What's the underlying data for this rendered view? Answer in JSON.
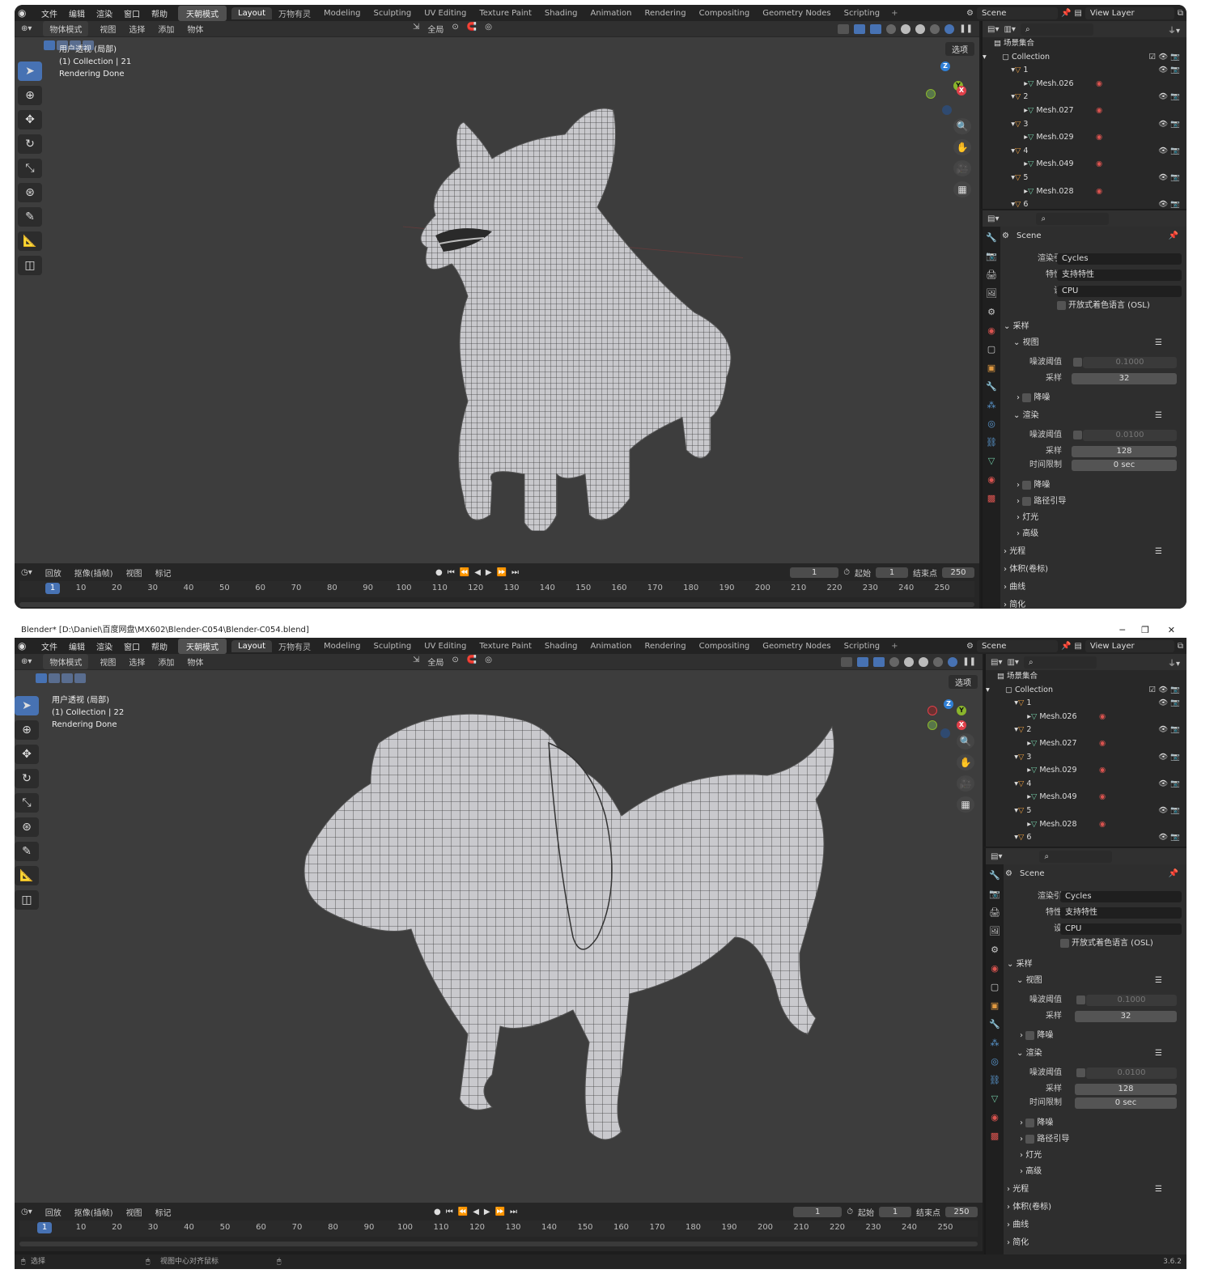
{
  "menu": {
    "items": [
      "文件",
      "编辑",
      "渲染",
      "窗口",
      "帮助"
    ],
    "mode_button": "天朝模式",
    "workspaces": [
      "Layout",
      "万物有灵",
      "Modeling",
      "Sculpting",
      "UV Editing",
      "Texture Paint",
      "Shading",
      "Animation",
      "Rendering",
      "Compositing",
      "Geometry Nodes",
      "Scripting"
    ],
    "add_workspace": "+",
    "scene": "Scene",
    "view_layer": "View Layer"
  },
  "window_title": "Blender* [D:\\Daniel\\百度网盘\\MX602\\Blender-C054\\Blender-C054.blend]",
  "viewport_header": {
    "mode": "物体模式",
    "items": [
      "视图",
      "选择",
      "添加",
      "物体"
    ],
    "transform": "全局",
    "options": "选项"
  },
  "viewport1": {
    "line1": "用户透视 (局部)",
    "line2": "(1) Collection | 21",
    "line3": "Rendering Done"
  },
  "viewport2": {
    "line1": "用户透视 (局部)",
    "line2": "(1) Collection | 22",
    "line3": "Rendering Done"
  },
  "timeline": {
    "items": [
      "回放",
      "抠像(插帧)",
      "视图",
      "标记"
    ],
    "current": "1",
    "start_label": "起始",
    "start": "1",
    "end_label": "结束点",
    "end": "250",
    "ticks": [
      "10",
      "20",
      "30",
      "40",
      "50",
      "60",
      "70",
      "80",
      "90",
      "100",
      "110",
      "120",
      "130",
      "140",
      "150",
      "160",
      "170",
      "180",
      "190",
      "200",
      "210",
      "220",
      "230",
      "240",
      "250"
    ]
  },
  "outliner": {
    "scene_collection": "场景集合",
    "collection": "Collection",
    "objects": [
      {
        "name": "1",
        "mesh": "Mesh.026"
      },
      {
        "name": "2",
        "mesh": "Mesh.027"
      },
      {
        "name": "3",
        "mesh": "Mesh.029"
      },
      {
        "name": "4",
        "mesh": "Mesh.049"
      },
      {
        "name": "5",
        "mesh": "Mesh.028"
      },
      {
        "name": "6",
        "mesh": ""
      }
    ]
  },
  "properties": {
    "scene": "Scene",
    "render_engine_label": "渲染引擎",
    "render_engine": "Cycles",
    "feature_set_label": "特性集",
    "feature_set": "支持特性",
    "device_label": "设备",
    "device": "CPU",
    "osl": "开放式着色语言 (OSL)",
    "sampling": "采样",
    "viewport": "视图",
    "noise_threshold_label": "噪波阈值",
    "viewport_noise": "0.1000",
    "samples_label": "采样",
    "viewport_samples": "32",
    "denoise": "降噪",
    "render": "渲染",
    "render_noise": "0.0100",
    "render_samples": "128",
    "time_limit_label": "时间限制",
    "time_limit": "0 sec",
    "path_guiding": "路径引导",
    "lights": "灯光",
    "advanced": "高级",
    "light_paths": "光程",
    "volumes": "体积(卷标)",
    "curves": "曲线",
    "simplify": "简化"
  },
  "statusbar": {
    "select": "选择",
    "center": "视图中心对齐鼠标",
    "version": "3.6.2"
  },
  "colors": {
    "accent": "#4772b3",
    "viewport_bg": "#3d3d3d",
    "object_icon": "#e09940",
    "mesh_icon": "#6fc5a1"
  }
}
